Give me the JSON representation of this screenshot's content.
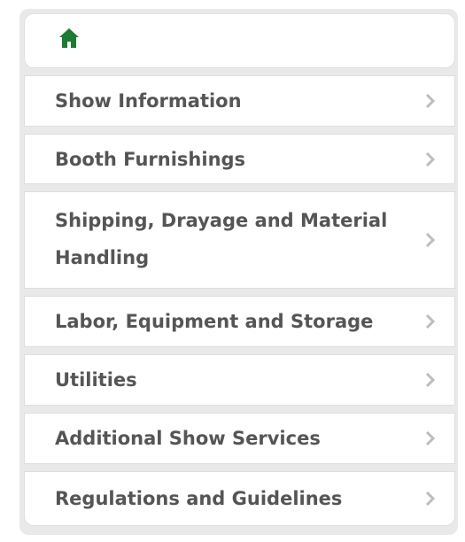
{
  "home": {
    "icon": "home-icon",
    "icon_color": "#1f7a33"
  },
  "menu": {
    "items": [
      {
        "label": "Show Information",
        "icon": "chevron-right-icon"
      },
      {
        "label": "Booth Furnishings",
        "icon": "chevron-right-icon"
      },
      {
        "label": "Shipping, Drayage and Material Handling",
        "icon": "chevron-right-icon"
      },
      {
        "label": "Labor, Equipment and Storage",
        "icon": "chevron-right-icon"
      },
      {
        "label": "Utilities",
        "icon": "chevron-right-icon"
      },
      {
        "label": "Additional Show Services",
        "icon": "chevron-right-icon"
      },
      {
        "label": "Regulations and Guidelines",
        "icon": "chevron-right-icon"
      }
    ]
  },
  "colors": {
    "text": "#555555",
    "chevron": "#bdbdbd",
    "panel_background": "#e9e9e9"
  }
}
